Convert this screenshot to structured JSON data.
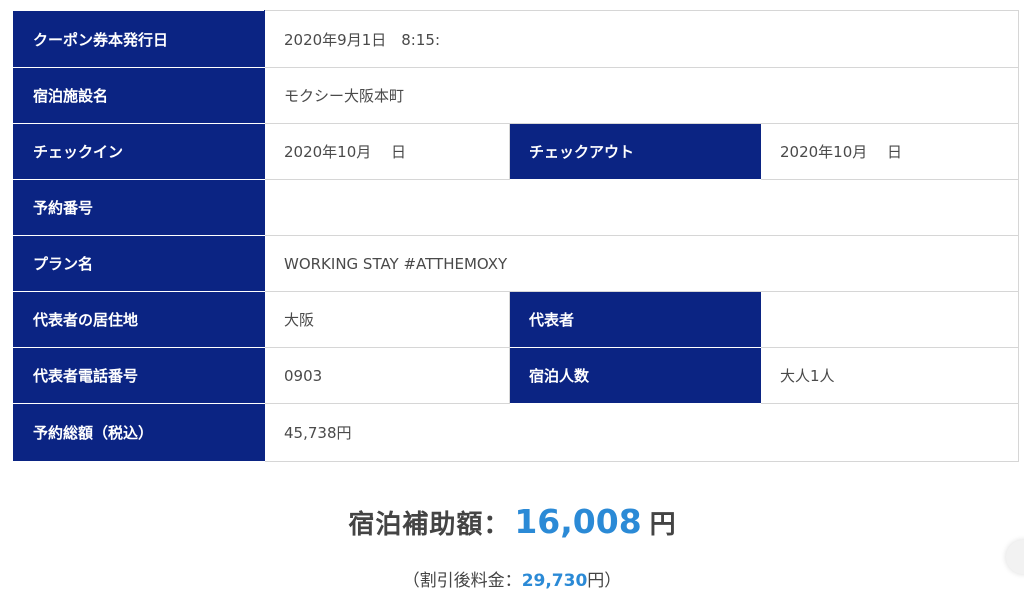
{
  "rows": [
    {
      "label": "クーポン券本発行日",
      "value": "2020年9月1日　8:15:"
    },
    {
      "label": "宿泊施設名",
      "value": "モクシー大阪本町"
    },
    {
      "label": "チェックイン",
      "value": "2020年10月　 日",
      "label2": "チェックアウト",
      "value2": "2020年10月　 日"
    },
    {
      "label": "予約番号",
      "value": ""
    },
    {
      "label": "プラン名",
      "value": "WORKING STAY #ATTHEMOXY"
    },
    {
      "label": "代表者の居住地",
      "value": "大阪",
      "label2": "代表者",
      "value2": ""
    },
    {
      "label": "代表者電話番号",
      "value": "0903",
      "label2": "宿泊人数",
      "value2": "大人1人"
    },
    {
      "label": "予約総額（税込）",
      "value": "45,738円"
    }
  ],
  "subsidy": {
    "label": "宿泊補助額：",
    "amount": "16,008",
    "unit": "円"
  },
  "discount": {
    "open": "（割引後料金：",
    "amount": "29,730",
    "close": "円）"
  },
  "colors": {
    "header_bg": "#0b2483",
    "accent": "#2b8ad6"
  }
}
